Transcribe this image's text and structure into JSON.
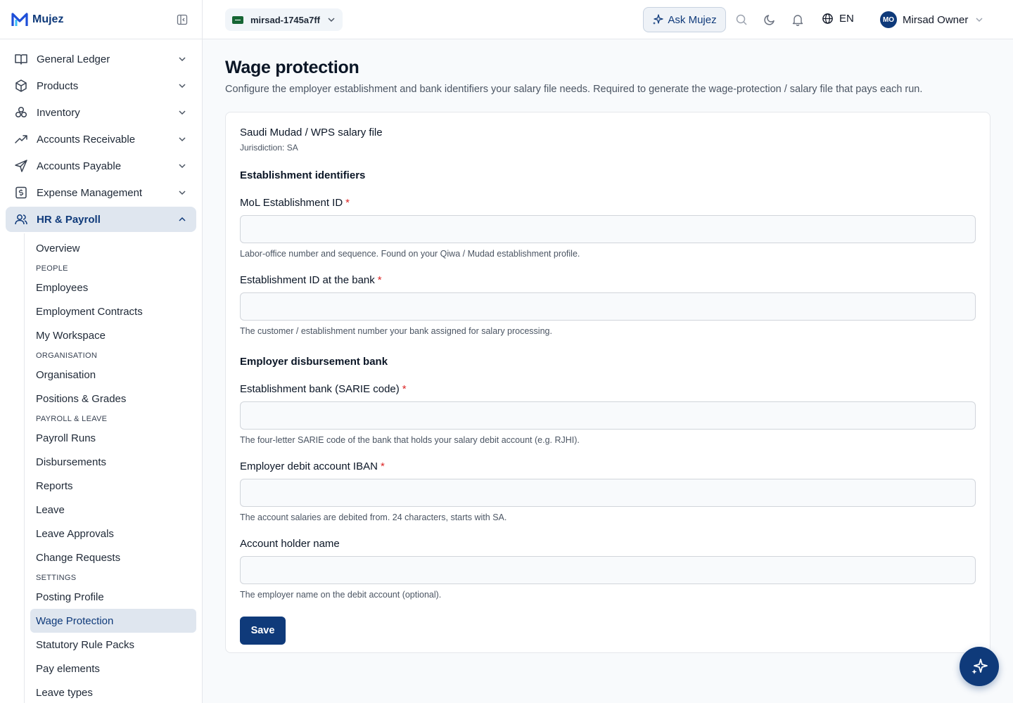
{
  "brand": {
    "name": "Mujez"
  },
  "sidebar": {
    "items": [
      {
        "label": "General Ledger",
        "icon": "book-icon"
      },
      {
        "label": "Products",
        "icon": "box-icon"
      },
      {
        "label": "Inventory",
        "icon": "boxes-icon"
      },
      {
        "label": "Accounts Receivable",
        "icon": "trending-up-icon"
      },
      {
        "label": "Accounts Payable",
        "icon": "send-icon"
      },
      {
        "label": "Expense Management",
        "icon": "receipt-icon"
      },
      {
        "label": "HR & Payroll",
        "icon": "users-icon"
      }
    ],
    "hr_sub": {
      "overview": "Overview",
      "people_head": "PEOPLE",
      "employees": "Employees",
      "contracts": "Employment Contracts",
      "workspace": "My Workspace",
      "org_head": "ORGANISATION",
      "organisation": "Organisation",
      "positions": "Positions & Grades",
      "payroll_head": "PAYROLL & LEAVE",
      "payroll_runs": "Payroll Runs",
      "disbursements": "Disbursements",
      "reports": "Reports",
      "leave": "Leave",
      "leave_approvals": "Leave Approvals",
      "change_requests": "Change Requests",
      "settings_head": "SETTINGS",
      "posting_profile": "Posting Profile",
      "wage_protection": "Wage Protection",
      "statutory": "Statutory Rule Packs",
      "pay_elements": "Pay elements",
      "leave_types": "Leave types"
    }
  },
  "topbar": {
    "org_name": "mirsad-1745a7ff",
    "ask_label": "Ask Mujez",
    "language": "EN",
    "user_initials": "MO",
    "user_name": "Mirsad Owner"
  },
  "page": {
    "title": "Wage protection",
    "description": "Configure the employer establishment and bank identifiers your salary file needs. Required to generate the wage-protection / salary file that pays each run."
  },
  "card": {
    "title": "Saudi Mudad / WPS salary file",
    "jurisdiction": "Jurisdiction: SA",
    "section1": "Establishment identifiers",
    "section2": "Employer disbursement bank",
    "fields": [
      {
        "label": "MoL Establishment ID",
        "required": "*",
        "value": "",
        "hint": "Labor-office number and sequence. Found on your Qiwa / Mudad establishment profile."
      },
      {
        "label": "Establishment ID at the bank",
        "required": "*",
        "value": "",
        "hint": "The customer / establishment number your bank assigned for salary processing."
      },
      {
        "label": "Establishment bank (SARIE code)",
        "required": "*",
        "value": "",
        "hint": "The four-letter SARIE code of the bank that holds your salary debit account (e.g. RJHI)."
      },
      {
        "label": "Employer debit account IBAN",
        "required": "*",
        "value": "",
        "hint": "The account salaries are debited from. 24 characters, starts with SA."
      },
      {
        "label": "Account holder name",
        "value": "",
        "hint": "The employer name on the debit account (optional)."
      }
    ],
    "save_label": "Save"
  },
  "colors": {
    "accent": "#0f3a7a",
    "required": "#dc2626",
    "active_bg": "#dfe6ef"
  }
}
